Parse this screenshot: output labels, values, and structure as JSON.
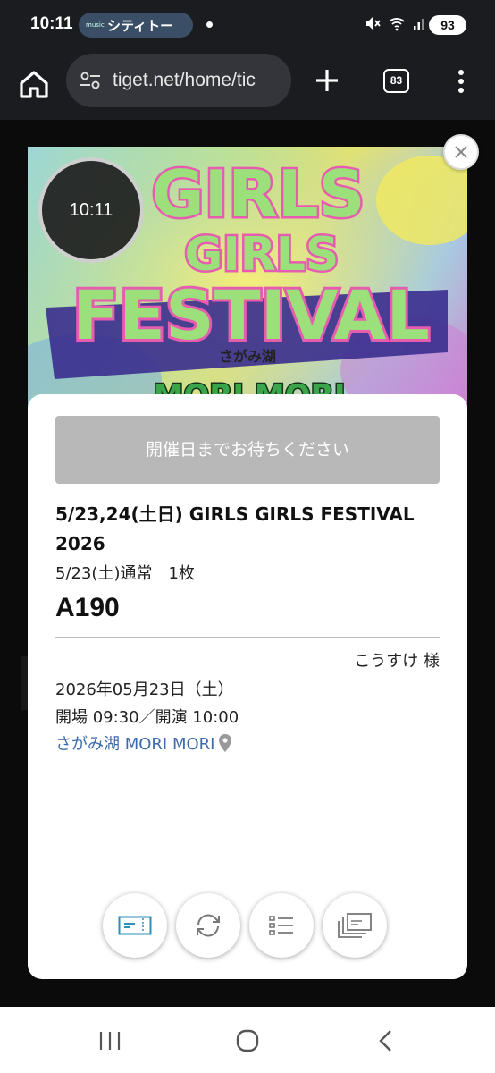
{
  "status_bar": {
    "time": "10:11",
    "notification_app": "music",
    "notification_text": "シティトー",
    "battery": "93"
  },
  "browser": {
    "url": "tiget.net/home/tic",
    "tab_count": "83"
  },
  "overlay": {
    "clock_time": "10:11"
  },
  "ticket": {
    "wait_button_label": "開催日までお待ちください",
    "event_title": "5/23,24(土日) GIRLS GIRLS FESTIVAL 2026",
    "ticket_type": "5/23(土)通常　1枚",
    "seat": "A190",
    "holder": "こうすけ 様",
    "date": "2026年05月23日（土）",
    "times": "開場 09:30／開演 10:00",
    "venue": "さがみ湖 MORI MORI"
  },
  "event_image": {
    "title_lines": [
      "GIRLS",
      "GIRLS",
      "FESTIVAL"
    ],
    "venue_small": "さがみ湖",
    "venue_logo": "MORI MORI"
  },
  "colors": {
    "accent_link": "#3d6aa8",
    "wait_button": "#b8b8b8",
    "festival_green": "#9be07a",
    "festival_pink": "#e65cae"
  },
  "icons": [
    "home-icon",
    "tune-icon",
    "plus-icon",
    "menu-dots-icon",
    "close-icon",
    "map-pin-icon",
    "ticket-icon",
    "refresh-icon",
    "list-icon",
    "tickets-stack-icon",
    "recent-apps-icon",
    "home-nav-icon",
    "back-icon"
  ]
}
